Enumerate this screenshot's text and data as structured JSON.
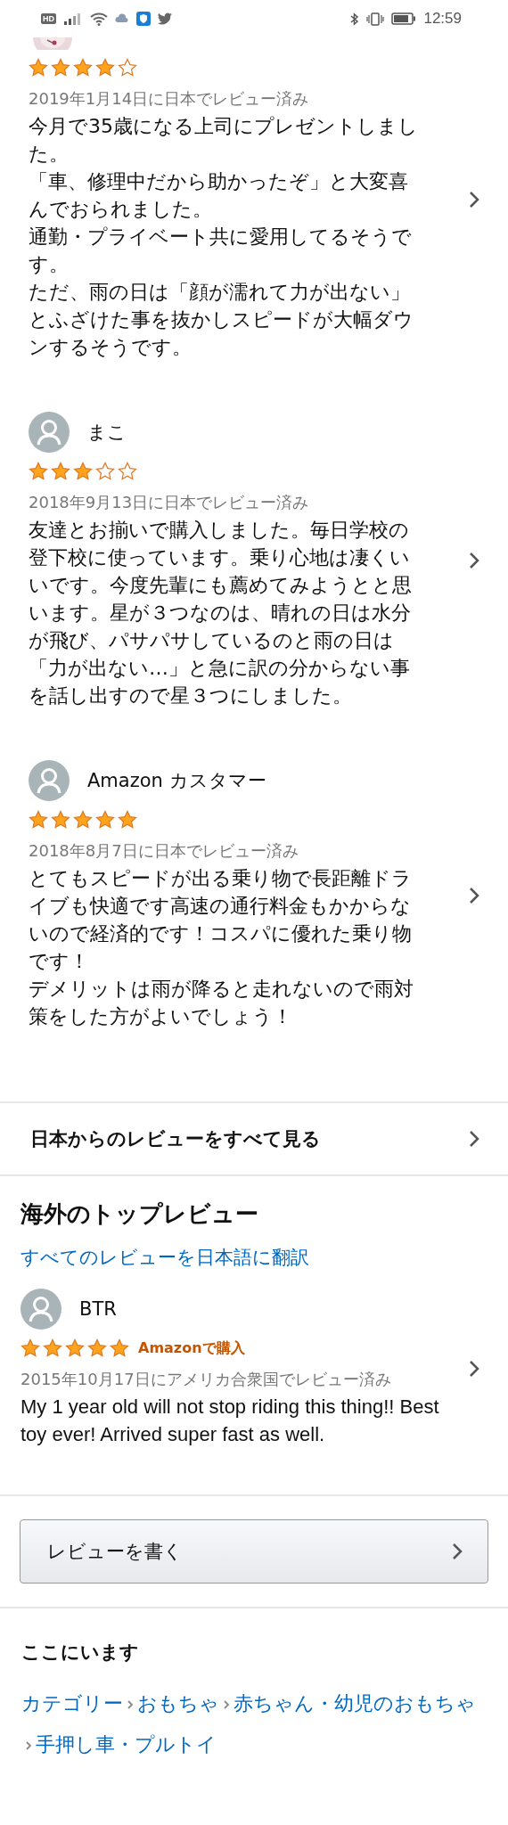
{
  "status_bar": {
    "time": "12:59",
    "left_badge": "HD"
  },
  "reviews": [
    {
      "stars": 4,
      "date": "2019年1月14日に日本でレビュー済み",
      "body": [
        "今月で35歳になる上司にプレゼントしました。",
        "「車、修理中だから助かったぞ」と大変喜んでおられました。",
        "通勤・プライベート共に愛用してるそうです。",
        "ただ、雨の日は「顔が濡れて力が出ない」とふざけた事を抜かしスピードが大幅ダウンするそうです。"
      ]
    },
    {
      "avatar": {
        "kind": "silhouette"
      },
      "name": "まこ",
      "stars": 3,
      "date": "2018年9月13日に日本でレビュー済み",
      "body": [
        "友達とお揃いで購入しました。毎日学校の登下校に使っています。乗り心地は凄くいいです。今度先輩にも薦めてみようとと思います。星が３つなのは、晴れの日は水分が飛び、パサパサしているのと雨の日は「力が出ない…」と急に訳の分からない事を話し出すので星３つにしました。"
      ]
    },
    {
      "avatar": {
        "kind": "silhouette"
      },
      "name": "Amazon カスタマー",
      "stars": 5,
      "date": "2018年8月7日に日本でレビュー済み",
      "body": [
        "とてもスピードが出る乗り物で長距離ドライブも快適です高速の通行料金もかからないので経済的です！コスパに優れた乗り物です！",
        "デメリットは雨が降ると走れないので雨対策をした方がよいでしょう！"
      ]
    }
  ],
  "all_reviews_link": {
    "label": "日本からのレビューをすべて見る"
  },
  "overseas": {
    "title": "海外のトップレビュー",
    "translate_link": "すべてのレビューを日本語に翻訳",
    "reviews": [
      {
        "avatar": {
          "kind": "silhouette"
        },
        "name": "BTR",
        "stars": 5,
        "badge": "Amazonで購入",
        "date": "2015年10月17日にアメリカ合衆国でレビュー済み",
        "body": "My 1 year old will not stop riding this thing!! Best toy ever! Arrived super fast as well."
      }
    ]
  },
  "write_review_button": {
    "label": "レビューを書く"
  },
  "breadcrumb": {
    "title": "ここにいます",
    "items": [
      "カテゴリー",
      "おもちゃ",
      "赤ちゃん・幼児のおもちゃ",
      "手押し車・プルトイ"
    ]
  }
}
